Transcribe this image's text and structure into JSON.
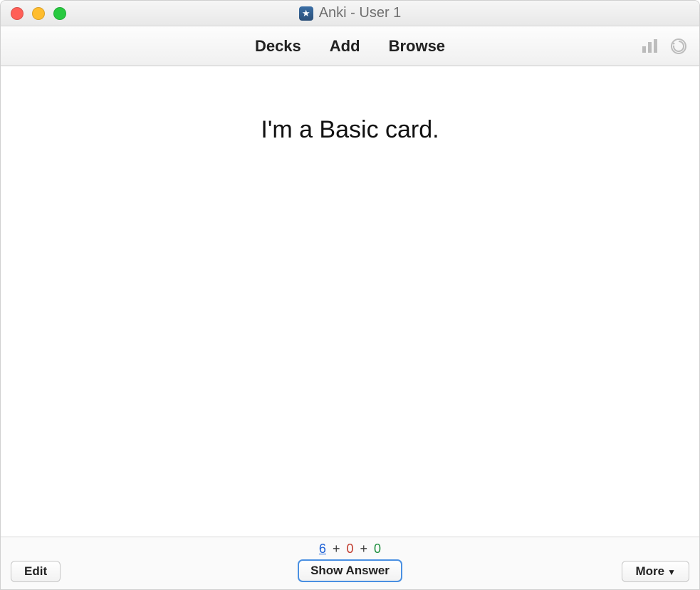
{
  "window": {
    "title": "Anki - User 1"
  },
  "toolbar": {
    "decks": "Decks",
    "add": "Add",
    "browse": "Browse"
  },
  "card": {
    "front": "I'm a Basic card."
  },
  "counts": {
    "new": "6",
    "learning": "0",
    "due": "0"
  },
  "buttons": {
    "edit": "Edit",
    "show_answer": "Show Answer",
    "more": "More"
  }
}
